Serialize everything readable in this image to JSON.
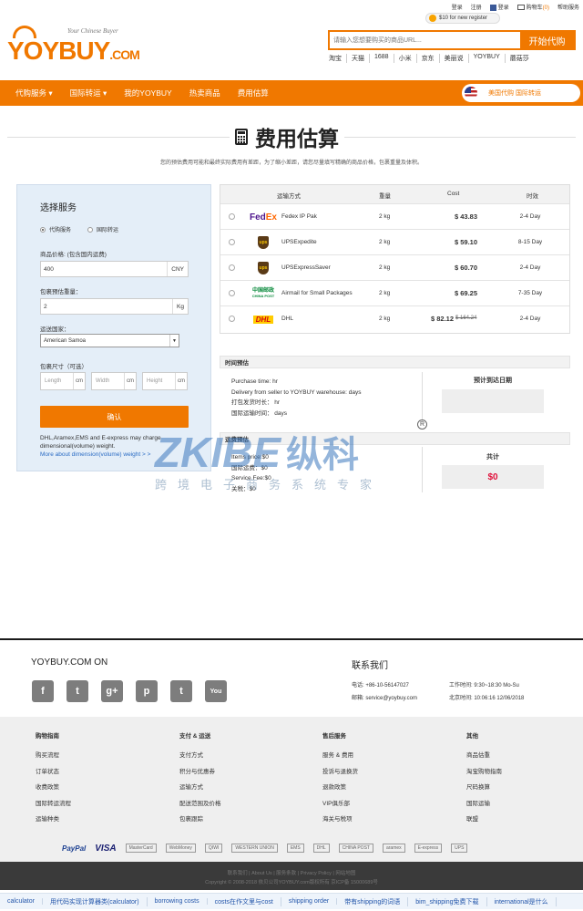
{
  "top": {
    "login": "登录",
    "register": "注册",
    "fb_login": "登录",
    "cart": "购物车",
    "cart_count": "(0)",
    "help": "帮助服务",
    "promo": "$10 for new register"
  },
  "logo": {
    "word": "YOYBUY",
    "com": ".COM",
    "tagline": "Your Chinese Buyer"
  },
  "search": {
    "placeholder": "请输入您想要购买的商品URL...",
    "button": "开始代购"
  },
  "shortcuts": [
    "淘宝",
    "天猫",
    "1688",
    "小米",
    "京东",
    "美丽说",
    "YOYBUY",
    "蘑菇莎"
  ],
  "nav": {
    "items": [
      "代购服务 ▾",
      "国际转运 ▾",
      "我的YOYBUY",
      "热卖商品",
      "费用估算"
    ],
    "pill": "美国代购  国际转运"
  },
  "page": {
    "title": "费用估算",
    "subtitle": "您的预估费用可能和最终实际费用有差距，为了缩小差距，请您尽量填写精确的商品价格，包裹重量及体积。"
  },
  "panel": {
    "heading": "选择服务",
    "radio1": "代购服务",
    "radio2": "国际转运",
    "price_label": "商品价格: (包含国内运费)",
    "price_value": "400",
    "price_unit": "CNY",
    "weight_label": "包裹预估重量：",
    "weight_value": "2",
    "weight_unit": "Kg",
    "country_label": "运送国家：",
    "country_value": "American Samoa",
    "size_label": "包裹尺寸（可选）",
    "length_ph": "Length",
    "width_ph": "Width",
    "height_ph": "Height",
    "cm": "cm",
    "confirm": "确认",
    "note": "DHL,Aramex,EMS and E-express may charge dimensional(volume) weight.",
    "note_link": "More about dimension(volume) weight > >"
  },
  "table": {
    "headers": {
      "method": "运输方式",
      "weight": "重量",
      "cost": "Cost",
      "time": "时效"
    },
    "rows": [
      {
        "carrier": "fedex-logo",
        "name": "Fedex IP Pak",
        "weight": "2 kg",
        "price": "$ 43.83",
        "old": "",
        "time": "2-4 Day"
      },
      {
        "carrier": "ups-logo",
        "name": "UPSExpedite",
        "weight": "2 kg",
        "price": "$ 59.10",
        "old": "",
        "time": "8-15 Day"
      },
      {
        "carrier": "ups-logo",
        "name": "UPSExpressSaver",
        "weight": "2 kg",
        "price": "$ 60.70",
        "old": "",
        "time": "2-4 Day"
      },
      {
        "carrier": "chinapost-logo",
        "name": "Airmail for Small Packages",
        "weight": "2 kg",
        "price": "$ 69.25",
        "old": "",
        "time": "7-35 Day"
      },
      {
        "carrier": "dhl-logo",
        "name": "DHL",
        "weight": "2 kg",
        "price": "$ 82.12",
        "old": "$ 164.24",
        "time": "2-4 Day"
      }
    ],
    "fedex_a": "Fed",
    "fedex_b": "Ex",
    "ups": "ups",
    "cpost": "中国邮政",
    "cpost_en": "CHINA POST",
    "dhl": "DHL"
  },
  "time": {
    "head": "时间预估",
    "purchase": "Purchase time: hr",
    "delivery": "Delivery from seller to YOYBUY warehouse: days",
    "pack": "打包发货时长： hr",
    "intl": "国际运输时间： days",
    "arrival_label": "预计到达日期"
  },
  "fees": {
    "head": "运费预估",
    "items": "Items price:$0",
    "intl": "国际运费：$0",
    "service": "Service Fee:$0",
    "tax": "关税：$0",
    "total_label": "共计",
    "total": "$0"
  },
  "watermark": {
    "brand": "ZKIBE",
    "cn": "纵科",
    "sub": "跨境电子商务系统专家",
    "reg": "R"
  },
  "footer": {
    "brand": "YOYBUY.COM ON",
    "social": [
      "f",
      "t",
      "g+",
      "p",
      "t",
      "You"
    ],
    "contact_title": "联系我们",
    "phone": "电话: +86-10-56147027",
    "email": "邮箱: service@yoybuy.com",
    "hours": "工作时间: 9:30~18:30 Mo-Su",
    "beijing": "北京时间: 10:06:16 12/06/2018"
  },
  "link_cols": [
    {
      "title": "购物指南",
      "items": [
        "购买流程",
        "订单状态",
        "收费政策",
        "国际转运流程",
        "运输种类"
      ]
    },
    {
      "title": "支付 & 运送",
      "items": [
        "支付方式",
        "积分与优惠券",
        "运输方式",
        "配送范围及价格",
        "包裹跟踪"
      ]
    },
    {
      "title": "售后服务",
      "items": [
        "服务 & 费用",
        "投诉与退换货",
        "退款政策",
        "VIP俱乐部",
        "海关与税项"
      ]
    },
    {
      "title": "其他",
      "items": [
        "商品估重",
        "淘宝购物指南",
        "尺码换算",
        "国际运输",
        "联盟"
      ]
    }
  ],
  "pay": [
    "PayPal",
    "VISA",
    "MasterCard",
    "WebMoney",
    "QIWI",
    "WESTERN UNION",
    "EMS",
    "DHL",
    "CHINA POST",
    "aramex",
    "E-express",
    "UPS"
  ],
  "bottom": {
    "line1": "联系我们 | About Us | 服务条款 | Privacy Policy | 网站地图",
    "line2": "Copyright © 2008-2018 依贝公司YOYBUY.com版权所有 京ICP备 15000689号"
  },
  "tags": [
    "calculator",
    "用代码实现计算器类(calculator)",
    "borrowing costs",
    "costs在作文里与cost",
    "shipping order",
    "带有shipping的词语",
    "bim_shipping免费下载",
    "international是什么"
  ]
}
